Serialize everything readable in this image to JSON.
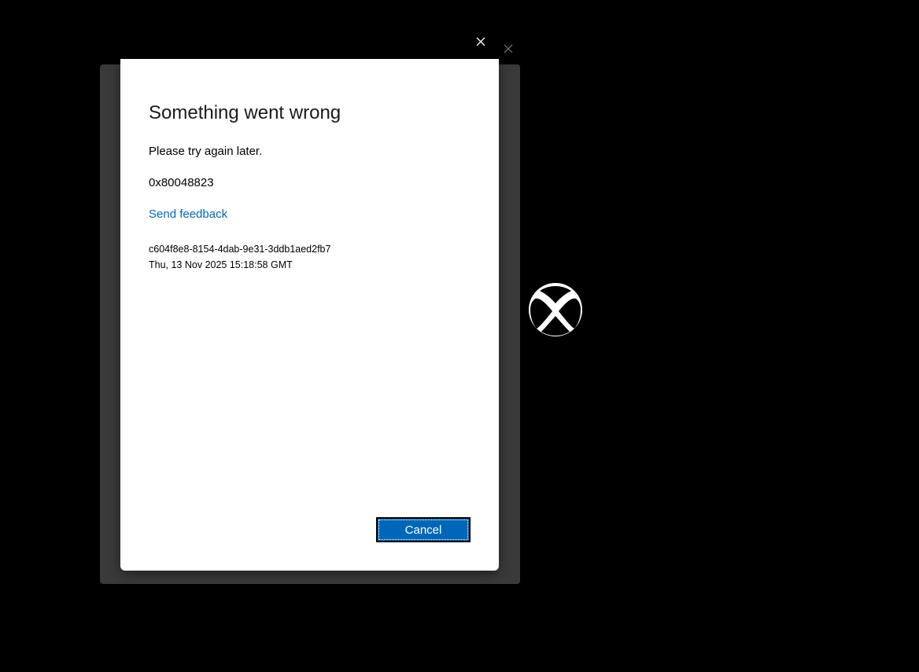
{
  "dialog": {
    "title": "Something went wrong",
    "message": "Please try again later.",
    "error_code": "0x80048823",
    "feedback_link": "Send feedback",
    "correlation_id": "c604f8e8-8154-4dab-9e31-3ddb1aed2fb7",
    "timestamp": "Thu, 13 Nov 2025 15:18:58 GMT",
    "cancel_label": "Cancel",
    "close_icon": "close-icon"
  },
  "host_window": {
    "close_icon": "close-icon"
  },
  "branding": {
    "logo_icon": "xbox-logo-icon"
  },
  "colors": {
    "background": "#000000",
    "host_window": "#3a3a3a",
    "dialog_background": "#ffffff",
    "accent": "#0067b8",
    "link": "#0067b8"
  }
}
